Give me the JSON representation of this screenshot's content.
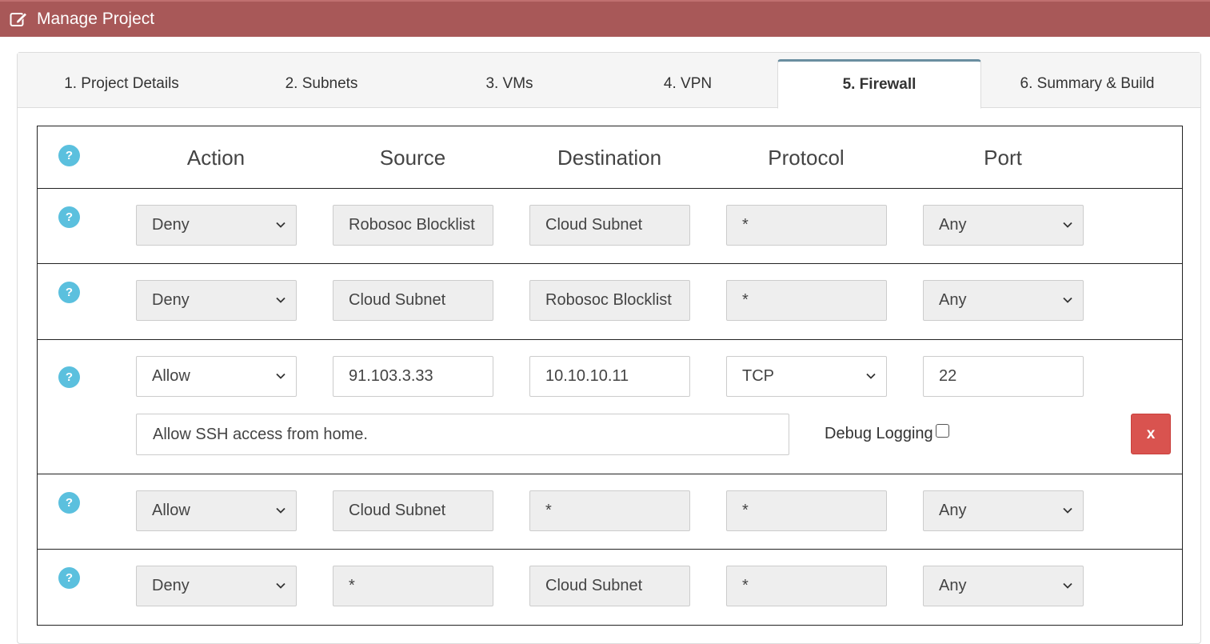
{
  "window": {
    "title": "Manage Project"
  },
  "tabs": [
    {
      "label": "1. Project Details"
    },
    {
      "label": "2. Subnets"
    },
    {
      "label": "3. VMs"
    },
    {
      "label": "4. VPN"
    },
    {
      "label": "5. Firewall",
      "active": true
    },
    {
      "label": "6. Summary & Build"
    }
  ],
  "table": {
    "help_glyph": "?",
    "headers": {
      "action": "Action",
      "source": "Source",
      "destination": "Destination",
      "protocol": "Protocol",
      "port": "Port"
    },
    "rules": [
      {
        "action": "Deny",
        "source": "Robosoc Blocklist",
        "destination": "Cloud Subnet",
        "protocol": "*",
        "port": "Any"
      },
      {
        "action": "Deny",
        "source": "Cloud Subnet",
        "destination": "Robosoc Blocklist",
        "protocol": "*",
        "port": "Any"
      },
      {
        "action": "Allow",
        "source": "91.103.3.33",
        "destination": "10.10.10.11",
        "protocol": "TCP",
        "port": "22",
        "description": "Allow SSH access from home.",
        "debug_label": "Debug Logging",
        "debug_checked": false,
        "delete_label": "x"
      },
      {
        "action": "Allow",
        "source": "Cloud Subnet",
        "destination": "*",
        "protocol": "*",
        "port": "Any"
      },
      {
        "action": "Deny",
        "source": "*",
        "destination": "Cloud Subnet",
        "protocol": "*",
        "port": "Any"
      }
    ]
  },
  "colors": {
    "titlebar": "#a85858",
    "help": "#5bc0de",
    "delete": "#d9534f",
    "active_tab_accent": "#6a8ea0"
  },
  "icons": {
    "title": "edit-icon",
    "help": "question-icon",
    "select": "chevron-down-icon"
  }
}
